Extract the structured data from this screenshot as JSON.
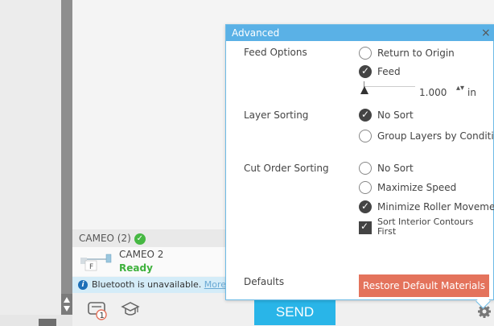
{
  "panel": {
    "title": "Advanced",
    "close": "×",
    "feed_options": {
      "label": "Feed Options",
      "return_origin": "Return to Origin",
      "feed": "Feed",
      "feed_value": "1.000",
      "unit_stepper": "▴▾",
      "unit": "in"
    },
    "layer_sorting": {
      "label": "Layer Sorting",
      "no_sort": "No Sort",
      "group": "Group Layers by Conditio"
    },
    "cut_order": {
      "label": "Cut Order Sorting",
      "no_sort": "No Sort",
      "max_speed": "Maximize Speed",
      "min_roller": "Minimize Roller Movemen",
      "sort_interior_line1": "Sort Interior Contours",
      "sort_interior_line2": "First"
    },
    "defaults": {
      "label": "Defaults",
      "restore": "Restore Default Materials"
    }
  },
  "devices": {
    "header": "CAMEO (2)",
    "name": "CAMEO 2",
    "status": "Ready",
    "icon_letter": "F"
  },
  "bluetooth": {
    "info_glyph": "i",
    "message": "Bluetooth is unavailable.",
    "link": "More Information"
  },
  "bottom": {
    "send": "SEND",
    "cutter_badge": "1"
  },
  "colors": {
    "accent": "#29b5e8",
    "panel_header": "#5ab1e6",
    "restore": "#e4735c",
    "ready": "#3eb13c"
  }
}
